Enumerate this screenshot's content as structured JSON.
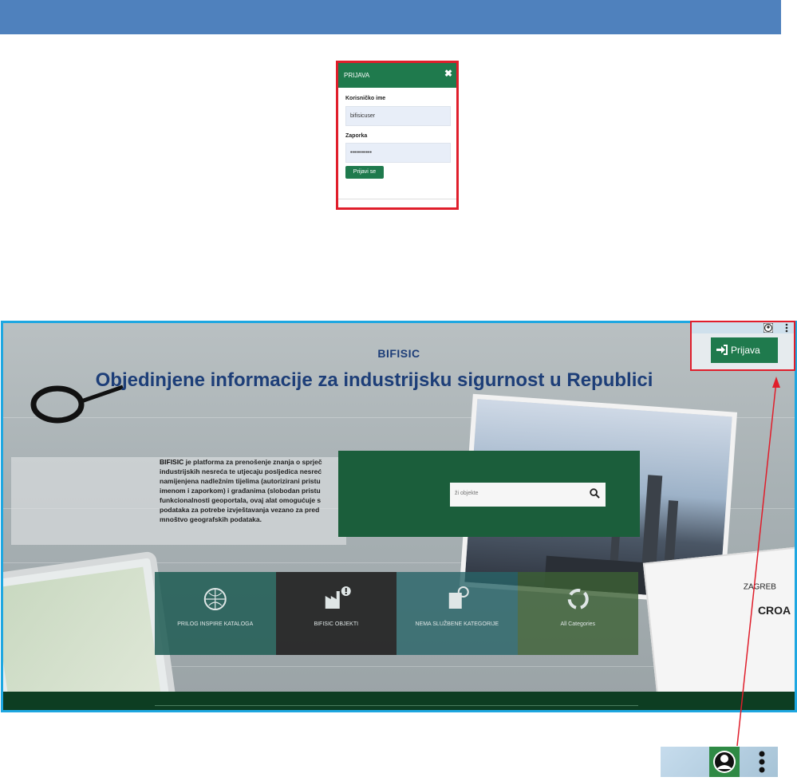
{
  "site": {
    "brand": "BIFISIC",
    "headline": "Objedinjene informacije za industrijsku sigurnost u Republici"
  },
  "description": {
    "bold": "BIFISIC",
    "lines": [
      " je platforma za prenošenje znanja o sprječ",
      "industrijskih nesreća te utjecaju posljedica nesreć",
      "namijenjena nadležnim tijelima (autorizirani pristu",
      "imenom i zaporkom) i građanima (slobodan pristu",
      "funkcionalnosti geoportala, ovaj alat omogućuje s",
      "podataka za potrebe izvještavanja vezano za pred",
      "mnoštvo geografskih podataka."
    ]
  },
  "search": {
    "placeholder": "ži objekte"
  },
  "categories": [
    {
      "label": "PRILOG INSPIRE KATALOGA",
      "icon": "globe-icon"
    },
    {
      "label": "BIFISIC OBJEKTI",
      "icon": "factory-alert-icon"
    },
    {
      "label": "NEMA SLUŽBENE KATEGORIJE",
      "icon": "notebook-globe-icon"
    },
    {
      "label": "All Categories",
      "icon": "recycle-icon"
    }
  ],
  "login_modal": {
    "title": "PRIJAVA",
    "username_label": "Korisničko ime",
    "username_value": "bifisicuser",
    "password_label": "Zaporka",
    "password_value": "•••••••••••",
    "submit_label": "Prijavi se"
  },
  "header_zoom": {
    "login_label": "Prijava"
  },
  "map_labels": {
    "zagreb": "ZAGREB",
    "croatia": "CROA"
  },
  "colors": {
    "doc_bar": "#4f81bd",
    "frame_border": "#1ea7e1",
    "highlight": "#e01e2b",
    "brand_green": "#1f7a4d",
    "title_blue": "#1d3e78"
  }
}
